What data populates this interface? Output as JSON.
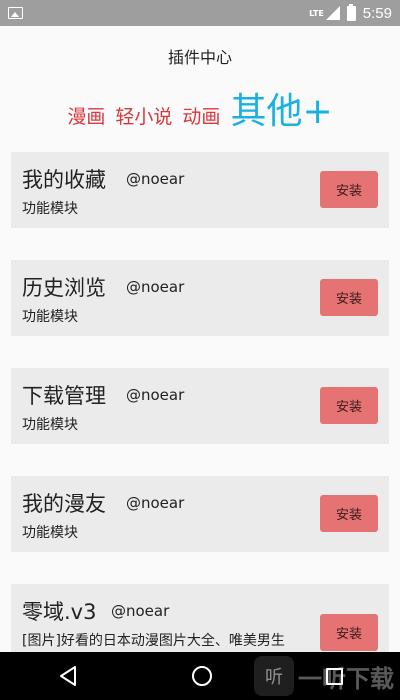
{
  "status_bar": {
    "network": "LTE",
    "time": "5:59"
  },
  "header": {
    "title": "插件中心"
  },
  "tabs": [
    {
      "label": "漫画",
      "active": false
    },
    {
      "label": "轻小说",
      "active": false
    },
    {
      "label": "动画",
      "active": false
    },
    {
      "label": "其他+",
      "active": true
    }
  ],
  "plugins": [
    {
      "title": "我的收藏",
      "author": "@noear",
      "desc": "功能模块",
      "button": "安装"
    },
    {
      "title": "历史浏览",
      "author": "@noear",
      "desc": "功能模块",
      "button": "安装"
    },
    {
      "title": "下载管理",
      "author": "@noear",
      "desc": "功能模块",
      "button": "安装"
    },
    {
      "title": "我的漫友",
      "author": "@noear",
      "desc": "功能模块",
      "button": "安装"
    },
    {
      "title": "零域.v3",
      "author": "@noear",
      "desc": "[图片]好看的日本动漫图片大全、唯美男生",
      "button": "安装"
    }
  ],
  "watermark": {
    "icon_text": "听",
    "text": "一听下载"
  },
  "colors": {
    "tab_inactive": "#d8383c",
    "tab_active": "#1ab0e0",
    "install_button": "#e57373"
  }
}
